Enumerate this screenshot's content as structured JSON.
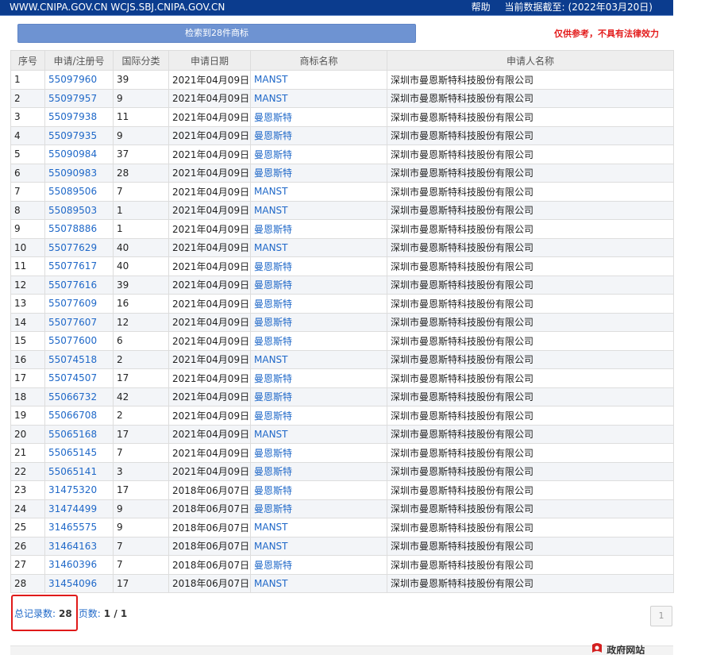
{
  "topbar": {
    "site_urls": "WWW.CNIPA.GOV.CN WCJS.SBJ.CNIPA.GOV.CN",
    "help": "帮助",
    "data_as_of_label": "当前数据截至:",
    "data_as_of_value": "(2022年03月20日)"
  },
  "search": {
    "result_label": "检索到28件商标",
    "disclaimer": "仅供参考，不具有法律效力"
  },
  "table": {
    "headers": [
      "序号",
      "申请/注册号",
      "国际分类",
      "申请日期",
      "商标名称",
      "申请人名称"
    ],
    "rows": [
      [
        "1",
        "55097960",
        "39",
        "2021年04月09日",
        "MANST",
        "深圳市曼恩斯特科技股份有限公司"
      ],
      [
        "2",
        "55097957",
        "9",
        "2021年04月09日",
        "MANST",
        "深圳市曼恩斯特科技股份有限公司"
      ],
      [
        "3",
        "55097938",
        "11",
        "2021年04月09日",
        "曼恩斯特",
        "深圳市曼恩斯特科技股份有限公司"
      ],
      [
        "4",
        "55097935",
        "9",
        "2021年04月09日",
        "曼恩斯特",
        "深圳市曼恩斯特科技股份有限公司"
      ],
      [
        "5",
        "55090984",
        "37",
        "2021年04月09日",
        "曼恩斯特",
        "深圳市曼恩斯特科技股份有限公司"
      ],
      [
        "6",
        "55090983",
        "28",
        "2021年04月09日",
        "曼恩斯特",
        "深圳市曼恩斯特科技股份有限公司"
      ],
      [
        "7",
        "55089506",
        "7",
        "2021年04月09日",
        "MANST",
        "深圳市曼恩斯特科技股份有限公司"
      ],
      [
        "8",
        "55089503",
        "1",
        "2021年04月09日",
        "MANST",
        "深圳市曼恩斯特科技股份有限公司"
      ],
      [
        "9",
        "55078886",
        "1",
        "2021年04月09日",
        "曼恩斯特",
        "深圳市曼恩斯特科技股份有限公司"
      ],
      [
        "10",
        "55077629",
        "40",
        "2021年04月09日",
        "MANST",
        "深圳市曼恩斯特科技股份有限公司"
      ],
      [
        "11",
        "55077617",
        "40",
        "2021年04月09日",
        "曼恩斯特",
        "深圳市曼恩斯特科技股份有限公司"
      ],
      [
        "12",
        "55077616",
        "39",
        "2021年04月09日",
        "曼恩斯特",
        "深圳市曼恩斯特科技股份有限公司"
      ],
      [
        "13",
        "55077609",
        "16",
        "2021年04月09日",
        "曼恩斯特",
        "深圳市曼恩斯特科技股份有限公司"
      ],
      [
        "14",
        "55077607",
        "12",
        "2021年04月09日",
        "曼恩斯特",
        "深圳市曼恩斯特科技股份有限公司"
      ],
      [
        "15",
        "55077600",
        "6",
        "2021年04月09日",
        "曼恩斯特",
        "深圳市曼恩斯特科技股份有限公司"
      ],
      [
        "16",
        "55074518",
        "2",
        "2021年04月09日",
        "MANST",
        "深圳市曼恩斯特科技股份有限公司"
      ],
      [
        "17",
        "55074507",
        "17",
        "2021年04月09日",
        "曼恩斯特",
        "深圳市曼恩斯特科技股份有限公司"
      ],
      [
        "18",
        "55066732",
        "42",
        "2021年04月09日",
        "曼恩斯特",
        "深圳市曼恩斯特科技股份有限公司"
      ],
      [
        "19",
        "55066708",
        "2",
        "2021年04月09日",
        "曼恩斯特",
        "深圳市曼恩斯特科技股份有限公司"
      ],
      [
        "20",
        "55065168",
        "17",
        "2021年04月09日",
        "MANST",
        "深圳市曼恩斯特科技股份有限公司"
      ],
      [
        "21",
        "55065145",
        "7",
        "2021年04月09日",
        "曼恩斯特",
        "深圳市曼恩斯特科技股份有限公司"
      ],
      [
        "22",
        "55065141",
        "3",
        "2021年04月09日",
        "曼恩斯特",
        "深圳市曼恩斯特科技股份有限公司"
      ],
      [
        "23",
        "31475320",
        "17",
        "2018年06月07日",
        "曼恩斯特",
        "深圳市曼恩斯特科技股份有限公司"
      ],
      [
        "24",
        "31474499",
        "9",
        "2018年06月07日",
        "曼恩斯特",
        "深圳市曼恩斯特科技股份有限公司"
      ],
      [
        "25",
        "31465575",
        "9",
        "2018年06月07日",
        "MANST",
        "深圳市曼恩斯特科技股份有限公司"
      ],
      [
        "26",
        "31464163",
        "7",
        "2018年06月07日",
        "MANST",
        "深圳市曼恩斯特科技股份有限公司"
      ],
      [
        "27",
        "31460396",
        "7",
        "2018年06月07日",
        "曼恩斯特",
        "深圳市曼恩斯特科技股份有限公司"
      ],
      [
        "28",
        "31454096",
        "17",
        "2018年06月07日",
        "MANST",
        "深圳市曼恩斯特科技股份有限公司"
      ]
    ]
  },
  "pager": {
    "total_label": "总记录数:",
    "total_value": "28",
    "pages_label": "页数:",
    "pages_value": "1 / 1",
    "page_button": "1"
  },
  "footer": {
    "gov_site_label": "政府网站"
  },
  "colors": {
    "topbar": "#0b3c8e",
    "search_bar": "#6e93d2",
    "link": "#1f68c8",
    "disclaimer": "#e31c1c",
    "highlight_box": "#e01a1a"
  }
}
